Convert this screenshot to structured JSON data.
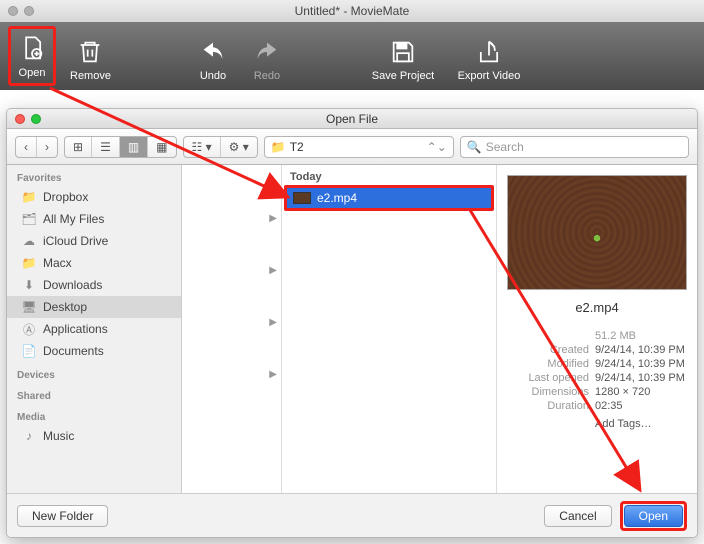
{
  "titlebar": {
    "title": "Untitled* - MovieMate"
  },
  "toolbar": {
    "open": "Open",
    "remove": "Remove",
    "undo": "Undo",
    "redo": "Redo",
    "save_project": "Save Project",
    "export_video": "Export Video"
  },
  "dialog": {
    "title": "Open File",
    "nav_back": "‹",
    "nav_fwd": "›",
    "path_current": "T2",
    "search_placeholder": "Search",
    "sidebar": {
      "sections": [
        "Favorites",
        "Devices",
        "Shared",
        "Media"
      ],
      "favorites": [
        "Dropbox",
        "All My Files",
        "iCloud Drive",
        "Macx",
        "Downloads",
        "Desktop",
        "Applications",
        "Documents"
      ],
      "media_items": [
        "Music"
      ],
      "selected": "Desktop"
    },
    "column2_header": "Today",
    "file_selected": "e2.mp4",
    "preview": {
      "name": "e2.mp4",
      "size": "51.2 MB",
      "created_label": "Created",
      "created_val": "9/24/14, 10:39 PM",
      "modified_label": "Modified",
      "modified_val": "9/24/14, 10:39 PM",
      "opened_label": "Last opened",
      "opened_val": "9/24/14, 10:39 PM",
      "dimensions_label": "Dimensions",
      "dimensions_val": "1280 × 720",
      "duration_label": "Duration",
      "duration_val": "02:35",
      "add_tags": "Add Tags…"
    },
    "footer": {
      "new_folder": "New Folder",
      "cancel": "Cancel",
      "open": "Open"
    }
  },
  "annotations": {
    "highlight_targets": [
      "open-tool",
      "file-row-selected",
      "open-button"
    ]
  }
}
